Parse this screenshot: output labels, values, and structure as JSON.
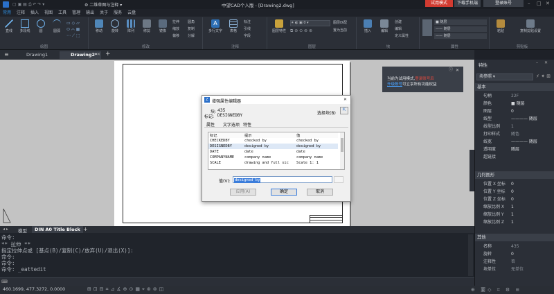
{
  "app": {
    "title_left": "二维草图与注释",
    "title_center": "中望CAD个人版 - [Drawing2.dwg]",
    "trial_btn": "试用模式",
    "download_btn": "下载手机端",
    "login_btn": "登录账号"
  },
  "menu": [
    "常用",
    "注释",
    "插入",
    "视图",
    "工具",
    "管理",
    "输出",
    "关于",
    "服务",
    "云盘"
  ],
  "ribbon": {
    "draw_group": "绘图",
    "modify_group": "修改",
    "annot_group": "注释",
    "layer_group": "图层",
    "block_group": "块",
    "props_group": "属性",
    "clip_group": "剪贴板",
    "draw_btns": [
      "直线",
      "多段线",
      "圆",
      "圆弧"
    ],
    "modify_btns": [
      "移动",
      "旋转",
      "阵列",
      "修剪",
      "镜像"
    ],
    "modify_small": [
      "拉伸",
      "缩放",
      "偏移",
      "圆角",
      "复制",
      "分解"
    ],
    "annot_btns": [
      "多行文字",
      "表格"
    ],
    "annot_small": [
      "标注",
      "引线",
      "字段"
    ],
    "layer_btns": [
      "图层特性"
    ],
    "layer_small": [
      "图层匹配",
      "置为当前"
    ],
    "block_btns": [
      "插入",
      "编辑"
    ],
    "block_small": [
      "创建",
      "编辑",
      "定义属性"
    ],
    "props_items": [
      "随层",
      "随层",
      "随层"
    ],
    "clip_btns": [
      "粘贴",
      "复制剪贴设置"
    ]
  },
  "doc_tabs": [
    "Drawing1",
    "Drawing2*"
  ],
  "layout_tabs": [
    "模型",
    "DIN A0 Title Block"
  ],
  "notification": {
    "line1": "当前为试用模式,",
    "line1_red": "登录账号后",
    "line2_link": "升级账号",
    "line2": "可立享所有功能权益"
  },
  "dialog": {
    "title": "增强属性编辑器",
    "block_label": "块:",
    "block_value": "435",
    "tag_label": "标记:",
    "tag_value": "DESIGNEDBY",
    "select_block": "选择块(B)",
    "tabs": [
      "属性",
      "文字选项",
      "特性"
    ],
    "columns": [
      "标记",
      "提示",
      "值"
    ],
    "rows": [
      [
        "CHECKEDBY",
        "checked by",
        "checked by"
      ],
      [
        "DESIGNEDBY",
        "designed by",
        "designed by"
      ],
      [
        "DATE",
        "date",
        "date"
      ],
      [
        "COMPANYNAME",
        "company name",
        "company name"
      ],
      [
        "SCALE",
        "drawing and full sic",
        "Scale    1: 1"
      ]
    ],
    "value_label": "值(V):",
    "value_text": "designed by",
    "apply": "应用(A)",
    "ok": "确定",
    "cancel": "取消"
  },
  "command": {
    "lines": [
      "命令:",
      "** 拉伸 **",
      "指定拉伸点或 [基点(B)/复制(C)/放弃(U)/退出(X)]:",
      "命令:",
      "命令:",
      "命令: _eattedit"
    ]
  },
  "status": {
    "coords": "460.1699, 477.3272, 0.0000"
  },
  "props_panel": {
    "title": "特性",
    "selector": "块参照",
    "basic": "基本",
    "basic_rows": [
      [
        "句柄",
        "22F"
      ],
      [
        "颜色",
        "■ 随层"
      ],
      [
        "图层",
        "0"
      ],
      [
        "线型",
        "———— 随层"
      ],
      [
        "线型比例",
        "1"
      ],
      [
        "打印样式",
        "随色"
      ],
      [
        "线宽",
        "———— 随层"
      ],
      [
        "透明度",
        "随层"
      ],
      [
        "超链接",
        ""
      ]
    ],
    "geom": "几何图形",
    "geom_rows": [
      [
        "位置 X 坐标",
        "0"
      ],
      [
        "位置 Y 坐标",
        "0"
      ],
      [
        "位置 Z 坐标",
        "0"
      ],
      [
        "缩放比例 X",
        "1"
      ],
      [
        "缩放比例 Y",
        "1"
      ],
      [
        "缩放比例 Z",
        "1"
      ]
    ],
    "misc": "其他",
    "misc_rows": [
      [
        "名称",
        "435"
      ],
      [
        "旋转",
        "0"
      ],
      [
        "注释性",
        "否"
      ],
      [
        "块单位",
        "无单位"
      ]
    ]
  }
}
